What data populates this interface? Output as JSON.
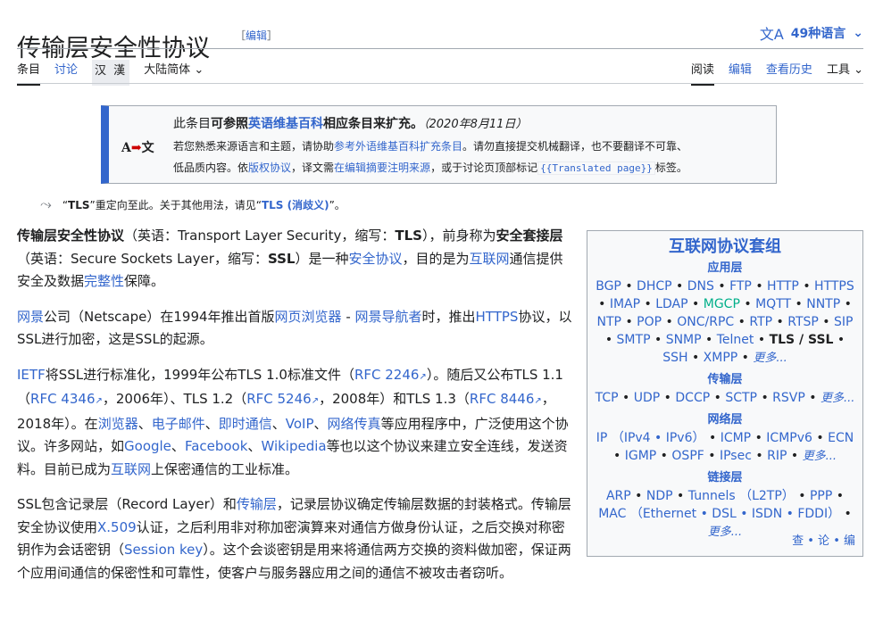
{
  "title": "传输层安全性协议",
  "edit": {
    "bracket_open": "［",
    "label": "编辑",
    "bracket_close": "］"
  },
  "lang_button": {
    "icon": "translate-icon",
    "icon_glyph": "文A",
    "label": "49种语言"
  },
  "tabs_left": [
    {
      "label": "条目",
      "active": true
    },
    {
      "label": "讨论",
      "active": false
    }
  ],
  "han_toggle": "汉 漢",
  "variant": "大陆简体",
  "tabs_right": [
    {
      "label": "阅读",
      "active": true
    },
    {
      "label": "编辑"
    },
    {
      "label": "查看历史"
    },
    {
      "label": "工具"
    }
  ],
  "ambox": {
    "icon_left": "A",
    "icon_right": "文",
    "pre": "此条目",
    "bold1": "可参照",
    "link1": "英语维基百科",
    "bold2": "相应条目来扩充",
    "period": "。",
    "date": "（2020年8月11日）",
    "l2a": "若您熟悉来源语言和主题，请协助",
    "l2link": "参考外语维基百科扩充条目",
    "l2b": "。请勿直接提交机械翻译，也不要翻译不可靠、",
    "l3a": "低品质内容。依",
    "l3link1": "版权协议",
    "l3b": "，译文需",
    "l3link2": "在编辑摘要注明来源",
    "l3c": "，或于讨论页顶部标记",
    "l3code": "{{Translated page}}",
    "l3d": "标签。"
  },
  "hatnote": {
    "q1": "“",
    "term": "TLS",
    "q2": "”重定向至此。关于其他用法，请见“",
    "link": "TLS (消歧义)",
    "q3": "”。"
  },
  "body": {
    "p1": {
      "b1": "传输层安全性协议",
      "t1": "（英语：Transport Layer Security，缩写：",
      "b2": "TLS",
      "t2": "），前身称为",
      "b3": "安全套接层",
      "t3": "（英语：Secure Sockets Layer，缩写：",
      "b4": "SSL",
      "t4": "）是一种",
      "l1": "安全协议",
      "t5": "，目的是为",
      "l2": "互联网",
      "t6": "通信提供安全及数据",
      "l3": "完整性",
      "t7": "保障。"
    },
    "p2": {
      "l1": "网景",
      "t1": "公司（Netscape）在1994年推出首版",
      "l2": "网页浏览器",
      "t2": " - ",
      "l3": "网景导航者",
      "t3": "时，推出",
      "l4": "HTTPS",
      "t4": "协议，以SSL进行加密，这是SSL的起源。"
    },
    "p3": {
      "l1": "IETF",
      "t1": "将SSL进行标准化，1999年公布TLS 1.0标准文件（",
      "l2": "RFC 2246",
      "t2": "）。随后又公布TLS 1.1（",
      "l3": "RFC 4346",
      "t3": "，2006年）、TLS 1.2（",
      "l4": "RFC 5246",
      "t4": "，2008年）和TLS 1.3（",
      "l5": "RFC 8446",
      "t5": "，2018年）。在",
      "l6": "浏览器",
      "s1": "、",
      "l7": "电子邮件",
      "s2": "、",
      "l8": "即时通信",
      "s3": "、",
      "l9": "VoIP",
      "s4": "、",
      "l10": "网络传真",
      "t6": "等应用程序中，广泛使用这个协议。许多网站，如",
      "l11": "Google",
      "s5": "、",
      "l12": "Facebook",
      "s6": "、",
      "l13": "Wikipedia",
      "t7": "等也以这个协议来建立安全连线，发送资料。目前已成为",
      "l14": "互联网",
      "t8": "上保密通信的工业标准。"
    },
    "p4": {
      "t1": "SSL包含记录层（Record Layer）和",
      "l1": "传输层",
      "t2": "，记录层协议确定传输层数据的封装格式。传输层安全协议使用",
      "l2": "X.509",
      "t3": "认证，之后利用非对称加密演算来对通信方做身份认证，之后交换对称密钥作为会话密钥（",
      "l3": "Session key",
      "t4": "）。这个会谈密钥是用来将通信两方交换的资料做加密，保证两个应用间通信的保密性和可靠性，使客户与服务器应用之间的通信不被攻击者窃听。"
    }
  },
  "navbox": {
    "title": "互联网协议套组",
    "sections": [
      {
        "head": "应用层",
        "items": [
          "BGP",
          "DHCP",
          "DNS",
          "FTP",
          "HTTP",
          "HTTPS",
          "IMAP",
          "LDAP",
          "MGCP",
          "MQTT",
          "NNTP",
          "NTP",
          "POP",
          "ONC/RPC",
          "RTP",
          "RTSP",
          "SIP",
          "SMTP",
          "SNMP",
          "Telnet",
          "TLS / SSL",
          "SSH",
          "XMPP"
        ],
        "more": "更多..."
      },
      {
        "head": "传输层",
        "items": [
          "TCP",
          "UDP",
          "DCCP",
          "SCTP",
          "RSVP"
        ],
        "more": "更多..."
      },
      {
        "head": "网络层",
        "items": [
          "IP （IPv4 • IPv6）",
          "ICMP",
          "ICMPv6",
          "ECN",
          "IGMP",
          "OSPF",
          "IPsec",
          "RIP"
        ],
        "more": "更多..."
      },
      {
        "head": "链接层",
        "items": [
          "ARP",
          "NDP",
          "Tunnels （L2TP）",
          "PPP",
          "MAC （Ethernet • DSL • ISDN • FDDI）"
        ],
        "more": "更多..."
      }
    ],
    "vde": "查 • 论 • 编"
  }
}
